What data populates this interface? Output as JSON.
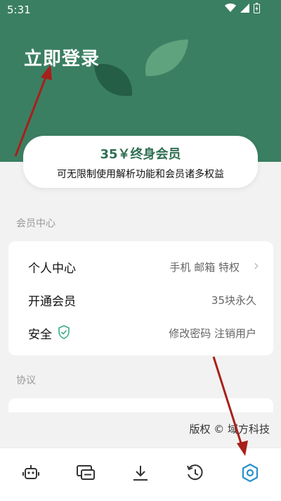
{
  "status_bar": {
    "time": "5:31"
  },
  "header": {
    "title": "立即登录"
  },
  "promo": {
    "title": "35￥终身会员",
    "subtitle": "可无限制使用解析功能和会员诸多权益"
  },
  "member_center": {
    "section_label": "会员中心",
    "items": [
      {
        "label": "个人中心",
        "value": "手机 邮箱 特权"
      },
      {
        "label": "开通会员",
        "value": "35块永久"
      },
      {
        "label": "安全",
        "value": "修改密码 注销用户"
      }
    ]
  },
  "agreement": {
    "section_label": "协议"
  },
  "footer": {
    "copyright": "版权 © 域方科技"
  },
  "bottom_nav": {
    "items": [
      {
        "icon": "robot-icon"
      },
      {
        "icon": "wallet-icon"
      },
      {
        "icon": "download-icon"
      },
      {
        "icon": "history-icon"
      },
      {
        "icon": "settings-icon",
        "active": true
      }
    ]
  },
  "colors": {
    "brand_green": "#3b7f63",
    "accent_blue": "#2a8fd0",
    "annotation_red": "#a8201a"
  }
}
